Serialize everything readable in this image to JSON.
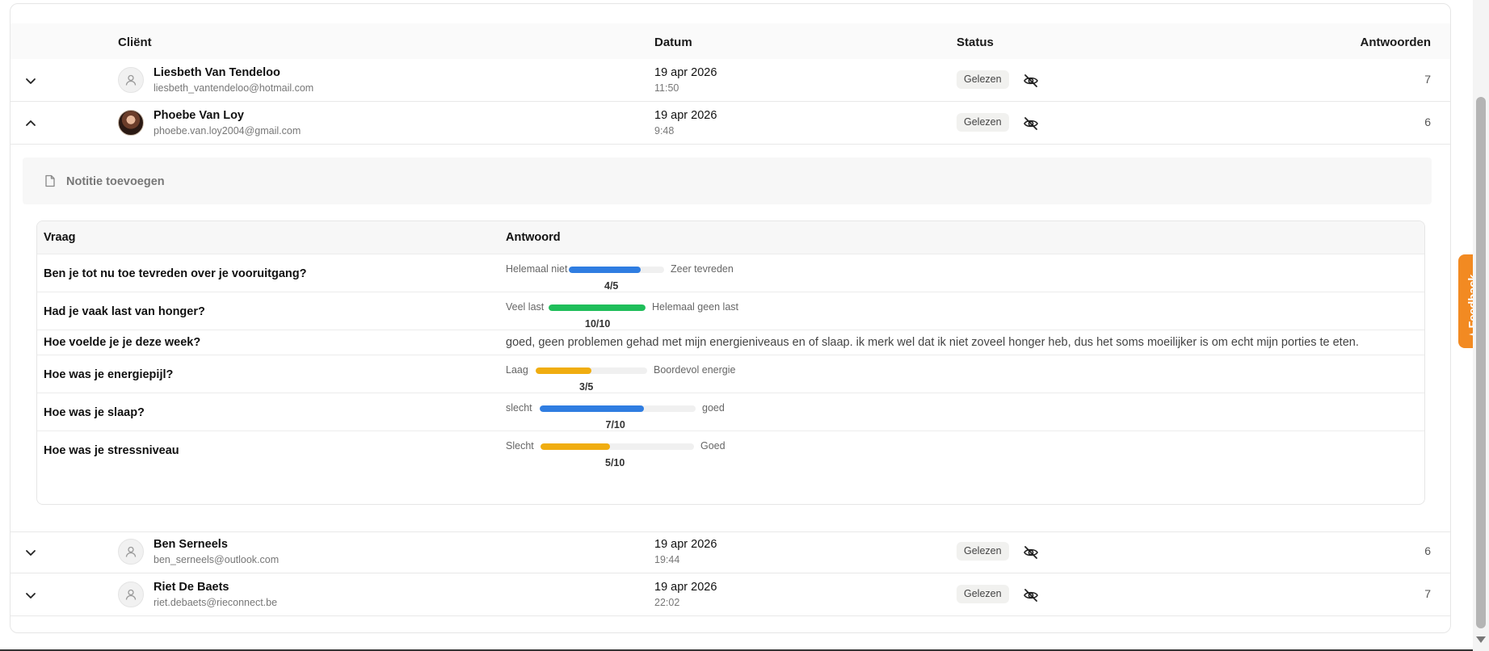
{
  "table": {
    "headers": {
      "client": "Cliënt",
      "date": "Datum",
      "status": "Status",
      "answers": "Antwoorden"
    },
    "rows": [
      {
        "name": "Liesbeth Van Tendeloo",
        "email": "liesbeth_vantendeloo@hotmail.com",
        "date": "19 apr 2026",
        "time": "11:50",
        "status": "Gelezen",
        "answers": "7",
        "expanded": false,
        "avatar": "user-icon"
      },
      {
        "name": "Phoebe Van Loy",
        "email": "phoebe.van.loy2004@gmail.com",
        "date": "19 apr 2026",
        "time": "9:48",
        "status": "Gelezen",
        "answers": "6",
        "expanded": true,
        "avatar": "photo"
      },
      {
        "name": "Ben Serneels",
        "email": "ben_serneels@outlook.com",
        "date": "19 apr 2026",
        "time": "19:44",
        "status": "Gelezen",
        "answers": "6",
        "expanded": false,
        "avatar": "user-icon"
      },
      {
        "name": "Riet De Baets",
        "email": "riet.debaets@rieconnect.be",
        "date": "19 apr 2026",
        "time": "22:02",
        "status": "Gelezen",
        "answers": "7",
        "expanded": false,
        "avatar": "user-icon"
      }
    ]
  },
  "detail": {
    "note_label": "Notitie toevoegen",
    "headers": {
      "question": "Vraag",
      "answer": "Antwoord"
    },
    "items": [
      {
        "question": "Ben je tot nu toe tevreden over je vooruitgang?",
        "type": "scale",
        "low": "Helemaal niet",
        "high": "Zeer tevreden",
        "score": "4/5",
        "fraction": 0.75,
        "color": "#2f7de1"
      },
      {
        "question": "Had je vaak last van honger?",
        "type": "scale",
        "low": "Veel last",
        "high": "Helemaal geen last",
        "score": "10/10",
        "fraction": 1.0,
        "color": "#1fbe5a"
      },
      {
        "question": "Hoe voelde je je deze week?",
        "type": "text",
        "answer": "goed, geen problemen gehad met mijn energieniveaus en of slaap. ik merk wel dat ik niet zoveel honger heb, dus het soms moeilijker is om echt mijn porties te eten."
      },
      {
        "question": "Hoe was je energiepijl?",
        "type": "scale",
        "low": "Laag",
        "high": "Boordevol energie",
        "score": "3/5",
        "fraction": 0.5,
        "color": "#f0ad10"
      },
      {
        "question": "Hoe was je slaap?",
        "type": "scale",
        "low": "slecht",
        "high": "goed",
        "score": "7/10",
        "fraction": 0.67,
        "color": "#2f7de1"
      },
      {
        "question": "Hoe was je stressniveau",
        "type": "scale",
        "low": "Slecht",
        "high": "Goed",
        "score": "5/10",
        "fraction": 0.45,
        "color": "#f0ad10"
      }
    ]
  },
  "feedback": {
    "label": "Feedback",
    "icon": "sparkle-icon"
  },
  "colors": {
    "badge_bg": "#f1f1ef",
    "accent_feedback": "#f28a22"
  }
}
